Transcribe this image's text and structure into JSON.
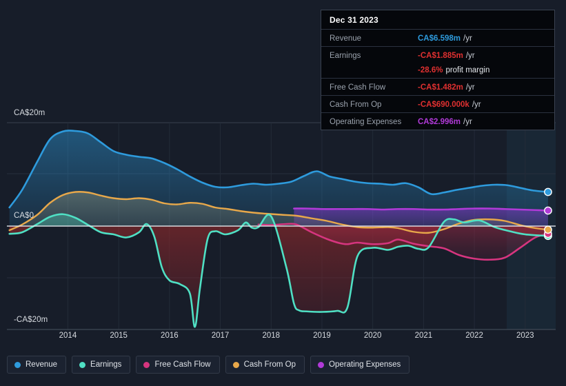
{
  "tooltip": {
    "date": "Dec 31 2023",
    "rows": [
      {
        "key": "Revenue",
        "value": "CA$6.598m",
        "unit": "/yr",
        "color": "#2e9bdd",
        "suffix": ""
      },
      {
        "key": "Earnings",
        "value": "-CA$1.885m",
        "unit": "/yr",
        "color": "#e03030",
        "suffix": ""
      },
      {
        "key": "",
        "value": "-28.6%",
        "unit": "",
        "color": "#e03030",
        "suffix": "profit margin"
      },
      {
        "key": "Free Cash Flow",
        "value": "-CA$1.482m",
        "unit": "/yr",
        "color": "#e03030",
        "suffix": ""
      },
      {
        "key": "Cash From Op",
        "value": "-CA$690.000k",
        "unit": "/yr",
        "color": "#e03030",
        "suffix": ""
      },
      {
        "key": "Operating Expenses",
        "value": "CA$2.996m",
        "unit": "/yr",
        "color": "#b13ad8",
        "suffix": ""
      }
    ]
  },
  "legend": {
    "items": [
      {
        "label": "Revenue",
        "color": "#2e9bdd"
      },
      {
        "label": "Earnings",
        "color": "#4fe0c4"
      },
      {
        "label": "Free Cash Flow",
        "color": "#d6357f"
      },
      {
        "label": "Cash From Op",
        "color": "#e8a84a"
      },
      {
        "label": "Operating Expenses",
        "color": "#b13ad8"
      }
    ]
  },
  "axes": {
    "y_labels": [
      "CA$20m",
      "CA$0",
      "-CA$20m"
    ],
    "x_labels": [
      "2014",
      "2015",
      "2016",
      "2017",
      "2018",
      "2019",
      "2020",
      "2021",
      "2022",
      "2023"
    ]
  },
  "chart_data": {
    "type": "area",
    "title": "",
    "xlabel": "",
    "ylabel": "CA$",
    "ylim": [
      -20,
      20
    ],
    "yticks": [
      20,
      10,
      0,
      -10,
      -20
    ],
    "ytick_labels": [
      "CA$20m",
      "",
      "CA$0",
      "",
      "-CA$20m"
    ],
    "grid": true,
    "legend_position": "bottom",
    "currency": "CA$",
    "units": "millions",
    "x_axis_years": [
      "2014",
      "2015",
      "2016",
      "2017",
      "2018",
      "2019",
      "2020",
      "2021",
      "2022",
      "2023"
    ],
    "x_range": [
      2013.3,
      2024.1
    ],
    "forecast_band_start": 2023.2,
    "series": [
      {
        "name": "Revenue",
        "color": "#2e9bdd",
        "x": [
          2013.35,
          2013.6,
          2013.9,
          2014.15,
          2014.4,
          2014.65,
          2014.9,
          2015.15,
          2015.4,
          2015.65,
          2015.9,
          2016.15,
          2016.4,
          2016.65,
          2016.9,
          2017.15,
          2017.4,
          2017.65,
          2017.9,
          2018.15,
          2018.4,
          2018.65,
          2018.9,
          2019.15,
          2019.4,
          2019.65,
          2019.9,
          2020.15,
          2020.4,
          2020.65,
          2020.9,
          2021.15,
          2021.4,
          2021.65,
          2021.9,
          2022.15,
          2022.4,
          2022.65,
          2022.9,
          2023.15,
          2023.4,
          2023.65,
          2023.95
        ],
        "y": [
          3.6,
          7.0,
          12.5,
          16.8,
          18.3,
          18.4,
          17.9,
          16.2,
          14.5,
          13.8,
          13.4,
          13.1,
          12.2,
          11.0,
          9.6,
          8.4,
          7.6,
          7.5,
          7.9,
          8.2,
          8.0,
          8.2,
          8.6,
          9.7,
          10.6,
          9.6,
          9.1,
          8.6,
          8.3,
          8.2,
          8.0,
          8.3,
          7.5,
          6.2,
          6.5,
          7.0,
          7.4,
          7.8,
          8.0,
          7.9,
          7.4,
          6.9,
          6.6
        ]
      },
      {
        "name": "Earnings",
        "color": "#4fe0c4",
        "x": [
          2013.35,
          2013.6,
          2013.9,
          2014.15,
          2014.4,
          2014.65,
          2014.9,
          2015.15,
          2015.4,
          2015.65,
          2015.9,
          2016.05,
          2016.2,
          2016.35,
          2016.5,
          2016.7,
          2016.9,
          2017.0,
          2017.1,
          2017.25,
          2017.4,
          2017.6,
          2017.85,
          2018.0,
          2018.12,
          2018.25,
          2018.5,
          2018.8,
          2018.95,
          2019.05,
          2019.2,
          2019.5,
          2019.8,
          2020.0,
          2020.2,
          2020.5,
          2020.8,
          2021.0,
          2021.2,
          2021.4,
          2021.6,
          2021.9,
          2022.1,
          2022.3,
          2022.6,
          2022.9,
          2023.2,
          2023.5,
          2023.95
        ],
        "y": [
          -1.5,
          -1.2,
          0.4,
          1.8,
          2.3,
          1.6,
          0.2,
          -1.2,
          -1.6,
          -2.2,
          -1.2,
          0.4,
          -2.0,
          -8.0,
          -10.5,
          -11.2,
          -13.0,
          -19.5,
          -12.0,
          -2.5,
          -1.0,
          -1.6,
          -0.8,
          0.7,
          -0.3,
          -0.2,
          1.9,
          -8.0,
          -15.0,
          -16.3,
          -16.5,
          -16.6,
          -16.4,
          -15.8,
          -5.8,
          -4.2,
          -4.6,
          -4.0,
          -3.8,
          -4.4,
          -4.1,
          0.8,
          1.3,
          0.7,
          1.1,
          -0.2,
          -1.0,
          -1.6,
          -1.9
        ]
      },
      {
        "name": "Free Cash Flow",
        "color": "#d6357f",
        "x": [
          2018.25,
          2018.5,
          2018.8,
          2019.0,
          2019.3,
          2019.6,
          2019.85,
          2020.0,
          2020.2,
          2020.5,
          2020.8,
          2021.0,
          2021.3,
          2021.6,
          2021.9,
          2022.2,
          2022.5,
          2022.8,
          2023.1,
          2023.4,
          2023.7,
          2023.95
        ],
        "y": [
          0.3,
          0.2,
          0.4,
          0.3,
          -1.2,
          -2.5,
          -3.3,
          -3.5,
          -3.2,
          -3.5,
          -3.3,
          -2.6,
          -3.4,
          -3.9,
          -4.3,
          -5.6,
          -6.3,
          -6.5,
          -6.1,
          -4.2,
          -2.2,
          -1.5
        ]
      },
      {
        "name": "Cash From Op",
        "color": "#e8a84a",
        "x": [
          2013.35,
          2013.6,
          2013.9,
          2014.15,
          2014.4,
          2014.65,
          2014.9,
          2015.15,
          2015.4,
          2015.65,
          2015.9,
          2016.15,
          2016.4,
          2016.65,
          2016.9,
          2017.15,
          2017.4,
          2017.65,
          2017.9,
          2018.15,
          2018.4,
          2018.7,
          2019.0,
          2019.3,
          2019.6,
          2019.9,
          2020.2,
          2020.5,
          2020.8,
          2021.0,
          2021.3,
          2021.6,
          2021.9,
          2022.2,
          2022.5,
          2022.8,
          2023.1,
          2023.4,
          2023.7,
          2023.95
        ],
        "y": [
          -0.8,
          0.3,
          2.2,
          4.5,
          6.0,
          6.6,
          6.5,
          5.9,
          5.4,
          5.2,
          5.4,
          5.1,
          4.4,
          4.2,
          4.5,
          4.3,
          3.6,
          3.3,
          2.9,
          2.6,
          2.4,
          2.2,
          2.0,
          1.5,
          1.0,
          0.3,
          -0.2,
          -0.3,
          -0.2,
          -0.4,
          -1.1,
          -1.3,
          -0.6,
          0.5,
          1.2,
          1.3,
          1.0,
          0.2,
          -0.4,
          -0.7
        ]
      },
      {
        "name": "Operating Expenses",
        "color": "#b13ad8",
        "x": [
          2018.95,
          2019.2,
          2019.5,
          2019.8,
          2020.1,
          2020.4,
          2020.7,
          2021.0,
          2021.3,
          2021.6,
          2021.9,
          2022.2,
          2022.5,
          2022.8,
          2023.1,
          2023.4,
          2023.7,
          2023.95
        ],
        "y": [
          3.4,
          3.4,
          3.3,
          3.3,
          3.3,
          3.3,
          3.2,
          3.3,
          3.3,
          3.2,
          3.2,
          3.3,
          3.4,
          3.4,
          3.3,
          3.2,
          3.1,
          3.0
        ]
      }
    ]
  }
}
